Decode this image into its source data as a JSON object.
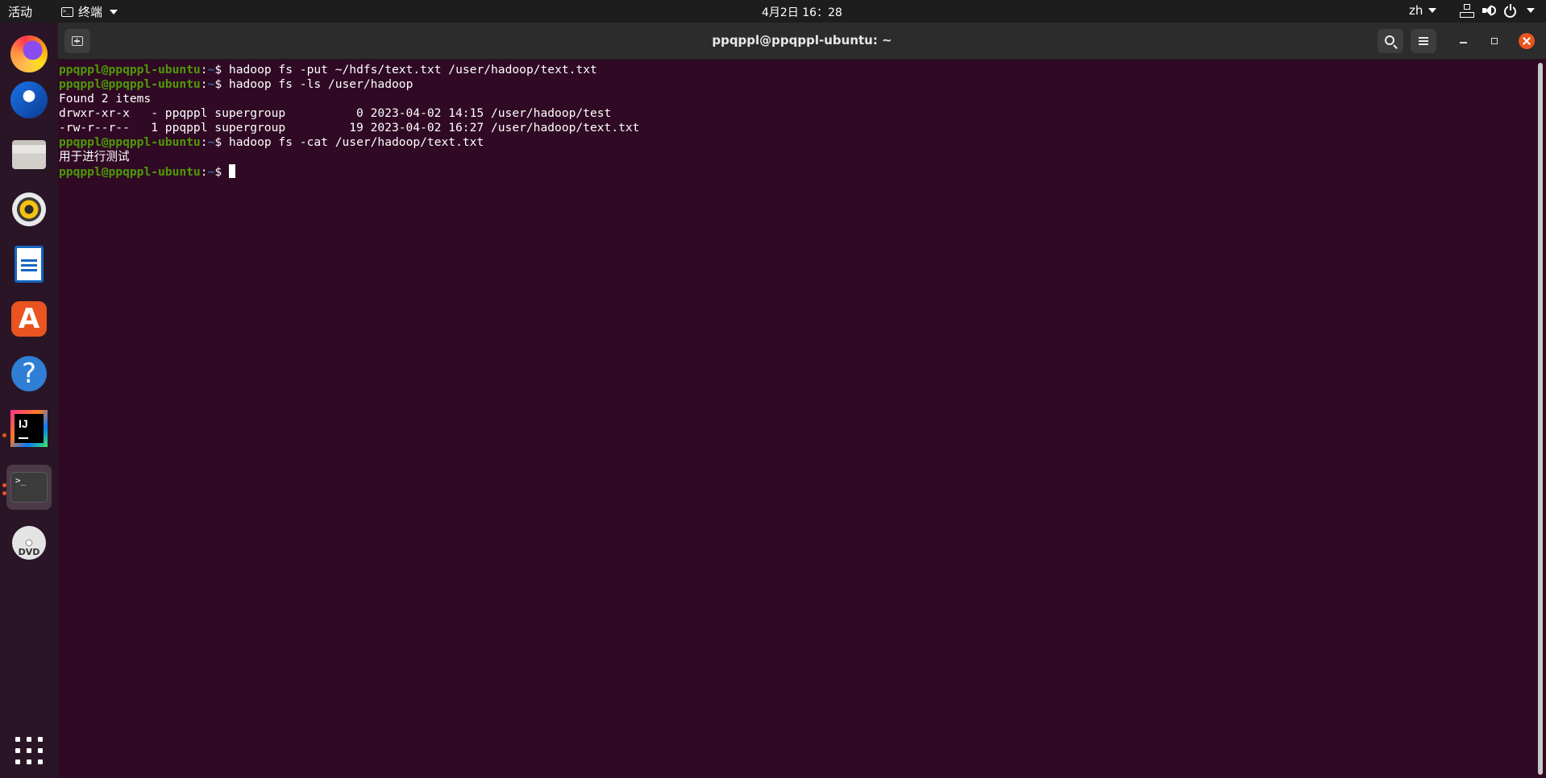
{
  "topbar": {
    "activities": "活动",
    "app_name": "终端",
    "clock": "4月2日 16：28",
    "language": "zh"
  },
  "dock": {
    "items": [
      {
        "name": "Firefox",
        "icon": "firefox-icon"
      },
      {
        "name": "Thunderbird",
        "icon": "thunderbird-icon"
      },
      {
        "name": "Files",
        "icon": "files-icon"
      },
      {
        "name": "Rhythmbox",
        "icon": "rhythmbox-icon"
      },
      {
        "name": "LibreOffice Writer",
        "icon": "writer-icon"
      },
      {
        "name": "Ubuntu Software",
        "icon": "app-store-icon",
        "glyph": "A"
      },
      {
        "name": "Help",
        "icon": "help-icon",
        "glyph": "?"
      },
      {
        "name": "IntelliJ IDEA",
        "icon": "intellij-icon",
        "glyph": "IJ",
        "running": true
      },
      {
        "name": "Terminal",
        "icon": "terminal-icon",
        "glyph": ">_",
        "running": true,
        "active": true
      },
      {
        "name": "DVD",
        "icon": "dvd-icon",
        "glyph": "DVD"
      }
    ]
  },
  "window": {
    "title": "ppqppl@ppqppl-ubuntu: ~"
  },
  "terminal": {
    "prompt_user": "ppqppl@ppqppl-ubuntu",
    "prompt_path": "~",
    "prompt_symbol": "$",
    "lines": [
      {
        "type": "cmd",
        "text": "hadoop fs -put ~/hdfs/text.txt /user/hadoop/text.txt"
      },
      {
        "type": "cmd",
        "text": "hadoop fs -ls /user/hadoop"
      },
      {
        "type": "out",
        "text": "Found 2 items"
      },
      {
        "type": "out",
        "text": "drwxr-xr-x   - ppqppl supergroup          0 2023-04-02 14:15 /user/hadoop/test"
      },
      {
        "type": "out",
        "text": "-rw-r--r--   1 ppqppl supergroup         19 2023-04-02 16:27 /user/hadoop/text.txt"
      },
      {
        "type": "cmd",
        "text": "hadoop fs -cat /user/hadoop/text.txt"
      },
      {
        "type": "out",
        "text": "用于进行测试"
      },
      {
        "type": "cmd",
        "text": "",
        "cursor": true
      }
    ]
  },
  "colors": {
    "terminal_bg": "#300a24",
    "prompt_user": "#4e9a06",
    "prompt_path": "#3465a4",
    "accent": "#e95420"
  }
}
